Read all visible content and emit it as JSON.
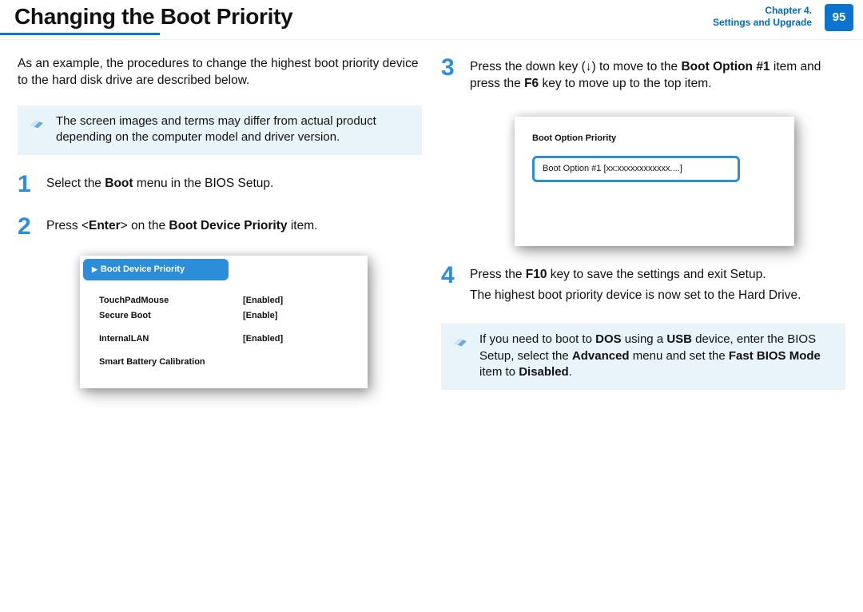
{
  "header": {
    "title": "Changing the Boot Priority",
    "chapter_line1": "Chapter 4.",
    "chapter_line2": "Settings and Upgrade",
    "page_number": "95"
  },
  "left": {
    "intro": "As an example, the procedures to change the highest boot priority device to the hard disk drive are described below.",
    "note": "The screen images and terms may differ from actual product depending on the computer model and driver version.",
    "step1_num": "1",
    "step1_a": "Select the ",
    "step1_b": "Boot",
    "step1_c": " menu in the BIOS Setup.",
    "step2_num": "2",
    "step2_a": "Press <",
    "step2_b": "Enter",
    "step2_c": "> on the ",
    "step2_d": "Boot Device Priority",
    "step2_e": " item.",
    "bios": {
      "highlight": "Boot Device Priority",
      "rows": [
        {
          "k": "TouchPadMouse",
          "v": "[Enabled]"
        },
        {
          "k": "Secure Boot",
          "v": "[Enable]"
        }
      ],
      "rows2": [
        {
          "k": "InternalLAN",
          "v": "[Enabled]"
        }
      ],
      "last": "Smart Battery Calibration"
    }
  },
  "right": {
    "step3_num": "3",
    "step3_a": "Press the down key (↓) to move to the ",
    "step3_b": "Boot Option #1",
    "step3_c": " item and press the ",
    "step3_d": "F6",
    "step3_e": " key to move up to the top item.",
    "bios2": {
      "title": "Boot Option Priority",
      "selected": "Boot Option #1 [xx:xxxxxxxxxxxx....]"
    },
    "step4_num": "4",
    "step4_a": "Press the ",
    "step4_b": "F10",
    "step4_c": " key to save the settings and exit Setup.",
    "step4_line2": "The highest boot priority device is now set to the Hard Drive.",
    "note_a": "If you need to boot to ",
    "note_b": "DOS",
    "note_c": " using a ",
    "note_d": "USB",
    "note_e": " device, enter the BIOS Setup, select the ",
    "note_f": "Advanced",
    "note_g": " menu and set the ",
    "note_h": "Fast BIOS Mode",
    "note_i": " item to ",
    "note_j": "Disabled",
    "note_k": "."
  }
}
